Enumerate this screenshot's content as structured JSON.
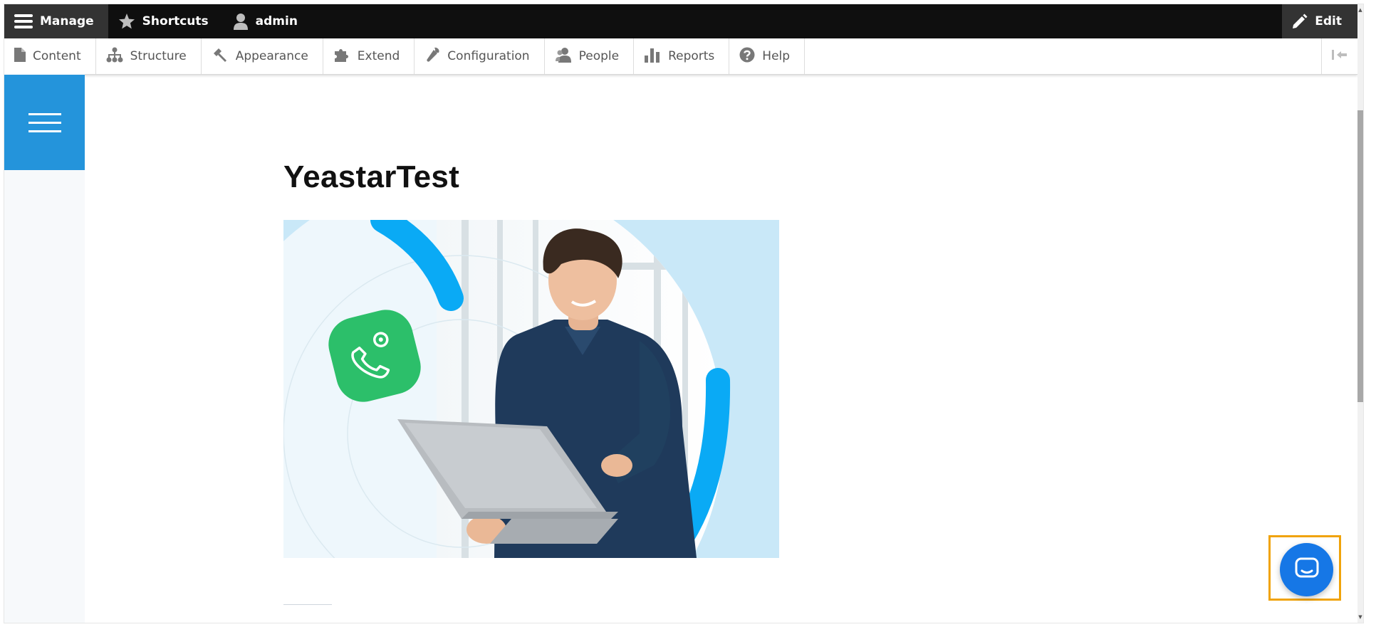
{
  "toolbar": {
    "manage_label": "Manage",
    "shortcuts_label": "Shortcuts",
    "user_label": "admin",
    "edit_label": "Edit"
  },
  "tray": {
    "items": [
      {
        "label": "Content",
        "icon": "file-icon"
      },
      {
        "label": "Structure",
        "icon": "sitemap-icon"
      },
      {
        "label": "Appearance",
        "icon": "paint-icon"
      },
      {
        "label": "Extend",
        "icon": "puzzle-icon"
      },
      {
        "label": "Configuration",
        "icon": "wrench-icon"
      },
      {
        "label": "People",
        "icon": "people-icon"
      },
      {
        "label": "Reports",
        "icon": "bar-chart-icon"
      },
      {
        "label": "Help",
        "icon": "help-icon"
      }
    ]
  },
  "page": {
    "title": "YeastarTest"
  },
  "colors": {
    "toolbar_bg": "#0f0f0f",
    "menu_blue": "#2494db",
    "chat_blue": "#1677e6",
    "highlight": "#f0a30a",
    "icon_green": "#2cbf6a",
    "arc_blue": "#0aaaf5"
  }
}
